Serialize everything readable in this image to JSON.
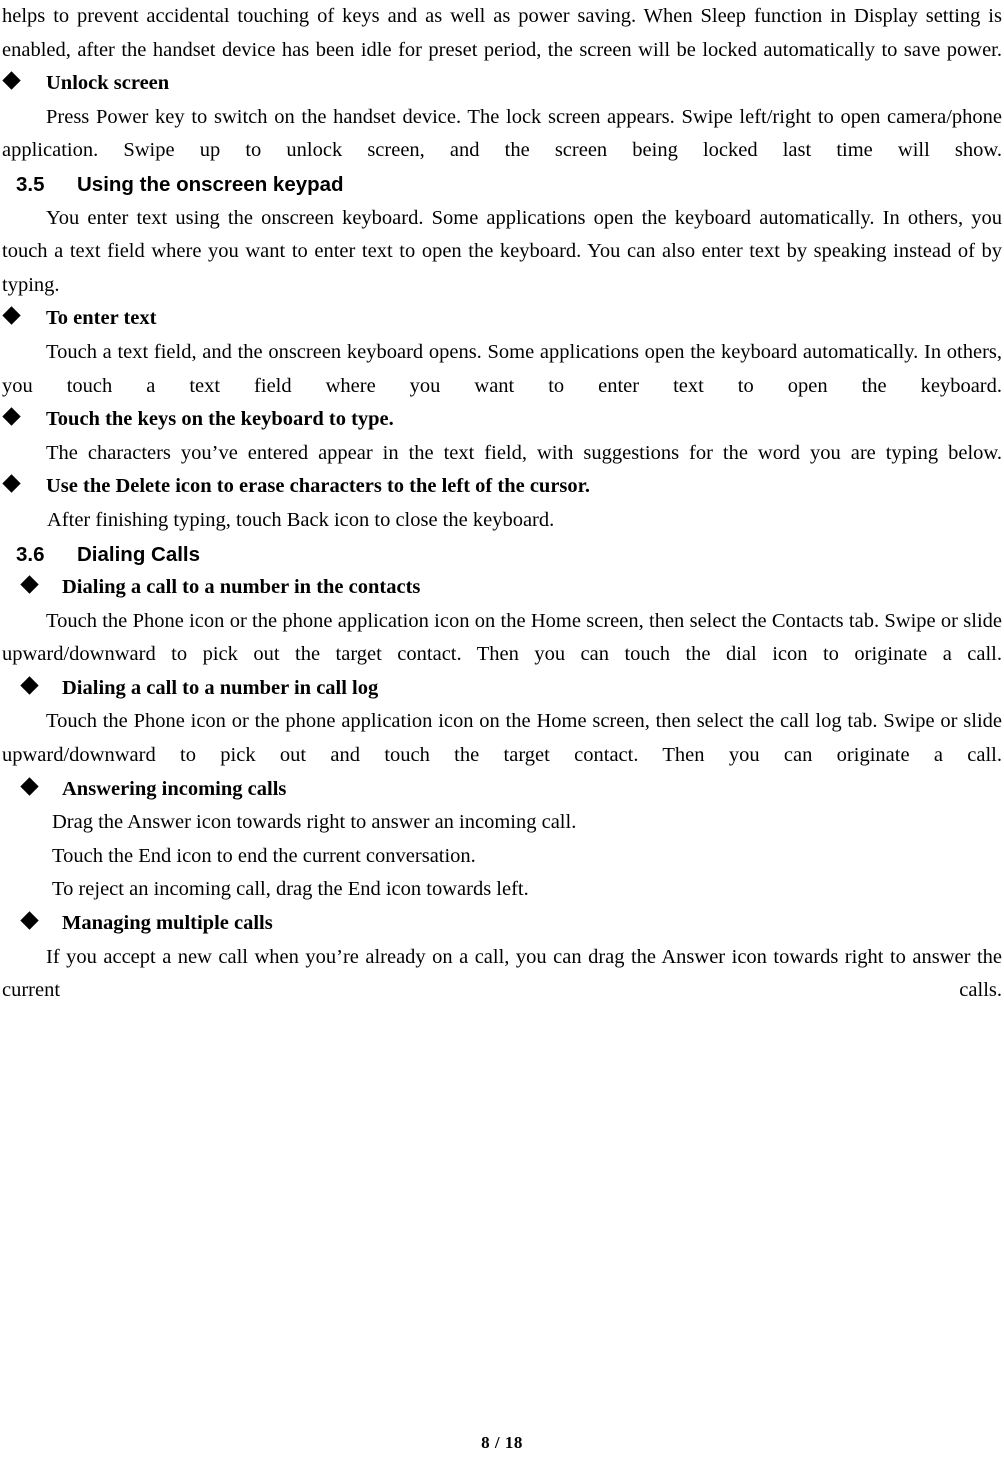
{
  "document": {
    "page_label": "8 / 18"
  },
  "blocks": {
    "intro_paragraph": "helps to prevent accidental touching of keys and as well as power saving.    When Sleep function in Display setting is enabled, after the handset device has been idle for preset period, the screen will be locked automatically to save power.",
    "unlock_screen_heading": "Unlock screen",
    "unlock_screen_body": "Press Power key to switch on the handset device. The lock screen appears. Swipe left/right to open camera/phone application. Swipe up to unlock screen, and the screen being locked last time will show.",
    "section_3_5_number": "3.5",
    "section_3_5_title": "Using the onscreen keypad",
    "section_3_5_body": "You enter text using the onscreen keyboard. Some applications open the keyboard automatically. In others, you touch a text field where you want to enter text to open the keyboard. You can also enter text by speaking instead of by typing.",
    "to_enter_text_heading": "To enter text",
    "to_enter_text_body": "Touch a text field, and the onscreen keyboard opens. Some applications open the keyboard automatically. In others, you touch a text field where you want to enter text to open the keyboard.",
    "touch_keys_heading": "Touch the keys on the keyboard to type.",
    "touch_keys_body": "The characters you’ve entered appear in the text field, with suggestions for the word you are typing below.",
    "delete_icon_heading": "Use the Delete icon to erase characters to the left of the cursor.",
    "delete_icon_body": "After finishing typing, touch Back icon to close the keyboard.",
    "section_3_6_number": "3.6",
    "section_3_6_title": "Dialing Calls",
    "dial_contacts_heading": "Dialing a call to a number in the contacts",
    "dial_contacts_body": "Touch the Phone icon or the phone application icon on the Home screen, then select the Contacts tab. Swipe or slide upward/downward to pick out the target contact. Then you can touch the dial icon to originate a call.",
    "dial_call_log_heading": "Dialing a call to a number in call log",
    "dial_call_log_body": "Touch the Phone icon or the phone application icon on the Home screen, then select the call log tab. Swipe or slide upward/downward to pick out and touch the target contact. Then you can originate a call.",
    "answering_calls_heading": "Answering incoming calls",
    "answering_calls_line_1": "Drag the Answer icon towards right to answer an incoming call.",
    "answering_calls_line_2": "Touch the End icon to end the current conversation.",
    "answering_calls_line_3": "To reject an incoming call, drag the End icon towards left.",
    "managing_calls_heading": "Managing multiple calls",
    "managing_calls_body": "If you accept a new call when you’re already on a call, you can drag the Answer icon towards right to answer the current calls."
  }
}
